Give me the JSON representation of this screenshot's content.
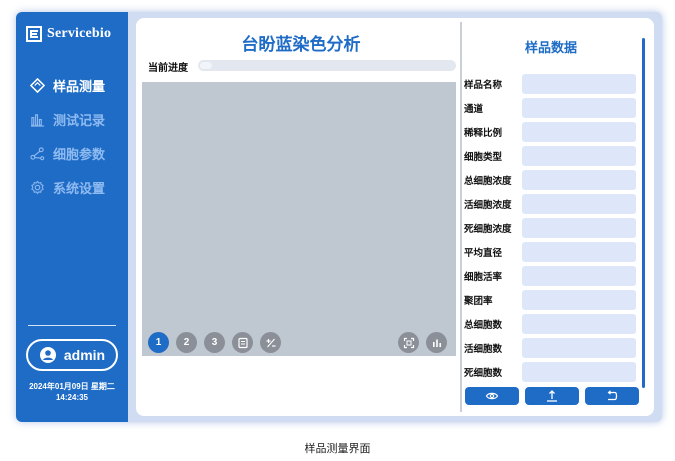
{
  "sidebar": {
    "logo_text": "Servicebio",
    "nav": [
      {
        "label": "样品测量",
        "icon": "diamond-icon",
        "active": true
      },
      {
        "label": "测试记录",
        "icon": "bar-chart-icon",
        "active": false
      },
      {
        "label": "细胞参数",
        "icon": "share-nodes-icon",
        "active": false
      },
      {
        "label": "系统设置",
        "icon": "gear-icon",
        "active": false
      }
    ],
    "user": "admin",
    "date": "2024年01月09日 星期二",
    "time": "14:24:35"
  },
  "main": {
    "title": "台盼蓝染色分析",
    "progress_label": "当前进度",
    "image_buttons": [
      "1",
      "2",
      "3"
    ]
  },
  "panel": {
    "title": "样品数据",
    "fields": [
      {
        "label": "样品名称",
        "value": ""
      },
      {
        "label": "通道",
        "value": ""
      },
      {
        "label": "稀释比例",
        "value": ""
      },
      {
        "label": "细胞类型",
        "value": ""
      },
      {
        "label": "总细胞浓度",
        "value": ""
      },
      {
        "label": "活细胞浓度",
        "value": ""
      },
      {
        "label": "死细胞浓度",
        "value": ""
      },
      {
        "label": "平均直径",
        "value": ""
      },
      {
        "label": "细胞活率",
        "value": ""
      },
      {
        "label": "聚团率",
        "value": ""
      },
      {
        "label": "总细胞数",
        "value": ""
      },
      {
        "label": "活细胞数",
        "value": ""
      },
      {
        "label": "死细胞数",
        "value": ""
      }
    ],
    "actions": [
      "eye-icon",
      "upload-icon",
      "back-icon"
    ]
  },
  "caption": "样品测量界面",
  "colors": {
    "accent": "#1f6cc7",
    "frame": "#cfdcf2",
    "input": "#dde7f9",
    "image_area": "#bfc7d1"
  }
}
